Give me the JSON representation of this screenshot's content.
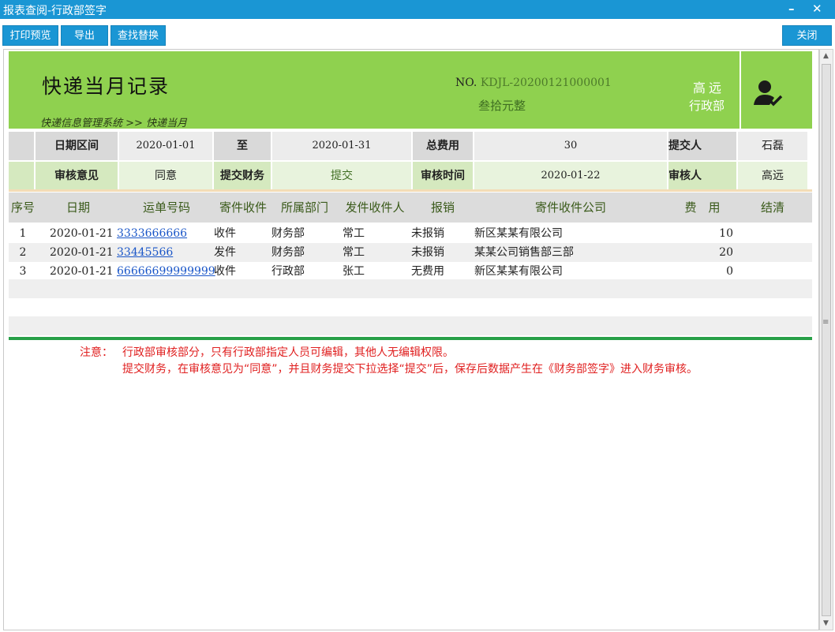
{
  "window": {
    "title": "报表查阅-行政部签字",
    "minimize": "–",
    "close": "✕"
  },
  "toolbar": {
    "print_preview": "打印预览",
    "export": "导出",
    "find_replace": "查找替换",
    "close": "关闭"
  },
  "header": {
    "title": "快递当月记录",
    "breadcrumb": "快递信息管理系统 >> 快递当月",
    "no_label": "NO.",
    "no_value": "KDJL-20200121000001",
    "amount_text": "叁拾元整",
    "person_name": "高远",
    "person_dept": "行政部",
    "icon": "user-approve-icon"
  },
  "summary": {
    "date_range_label": "日期区间",
    "date_from": "2020-01-01",
    "to_label": "至",
    "date_to": "2020-01-31",
    "total_fee_label": "总费用",
    "total_fee": "30",
    "submitter_label": "提交人",
    "submitter": "石磊",
    "review_opinion_label": "审核意见",
    "review_opinion": "同意",
    "submit_finance_label": "提交财务",
    "submit_finance": "提交",
    "review_time_label": "审核时间",
    "review_time": "2020-01-22",
    "reviewer_label": "审核人",
    "reviewer": "高远"
  },
  "table": {
    "columns": [
      "序号",
      "日期",
      "运单号码",
      "寄件收件",
      "所属部门",
      "发件收件人",
      "报销",
      "寄件收件公司",
      "费　用",
      "结清"
    ],
    "rows": [
      {
        "index": "1",
        "date": "2020-01-21",
        "waybill": "3333666666",
        "type": "收件",
        "dept": "财务部",
        "person": "常工",
        "reimburse": "未报销",
        "company": "新区某某有限公司",
        "fee": "10",
        "settled": ""
      },
      {
        "index": "2",
        "date": "2020-01-21",
        "waybill": "33445566",
        "type": "发件",
        "dept": "财务部",
        "person": "常工",
        "reimburse": "未报销",
        "company": "某某公司销售部三部",
        "fee": "20",
        "settled": ""
      },
      {
        "index": "3",
        "date": "2020-01-21",
        "waybill": "66666699999999",
        "type": "收件",
        "dept": "行政部",
        "person": "张工",
        "reimburse": "无费用",
        "company": "新区某某有限公司",
        "fee": "0",
        "settled": ""
      }
    ]
  },
  "notes": {
    "prefix": "注意：",
    "line1": "行政部审核部分，只有行政部指定人员可编辑，其他人无编辑权限。",
    "line2": "提交财务，在审核意见为“同意”，并且财务提交下拉选择“提交”后，保存后数据产生在《财务部签字》进入财务审核。"
  },
  "colors": {
    "titlebar": "#1a96d4",
    "header_green": "#8fd14f",
    "link": "#1a56c8",
    "note_red": "#e02020",
    "divider_green": "#28a048"
  }
}
